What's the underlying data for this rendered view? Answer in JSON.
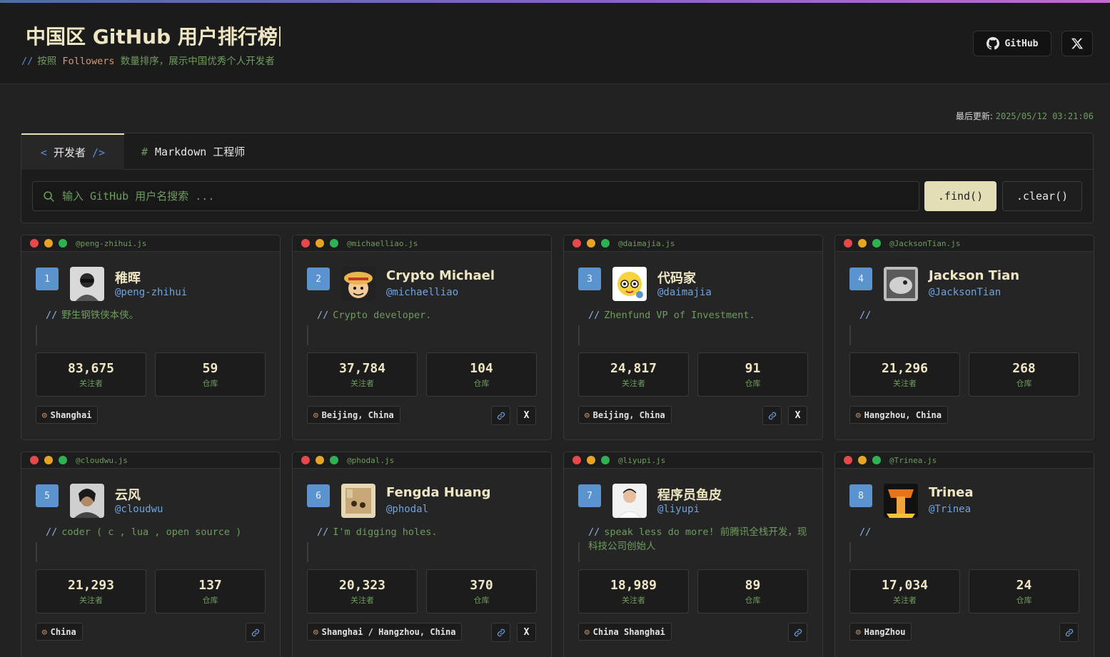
{
  "header": {
    "title": "中国区 GitHub 用户排行榜",
    "subtitle_slash": "//",
    "subtitle_pre": "按照 ",
    "subtitle_highlight": "Followers",
    "subtitle_post": " 数量排序，展示中国优秀个人开发者",
    "github_label": "GitHub"
  },
  "updated": {
    "label": "最后更新:",
    "timestamp": "2025/05/12 03:21:06"
  },
  "tabs": {
    "developers": {
      "open": "<",
      "label": "开发者",
      "close": "/>"
    },
    "markdown": {
      "hash": "#",
      "label": "Markdown 工程师"
    }
  },
  "search": {
    "placeholder": "输入 GitHub 用户名搜索 ...",
    "find_label": ".find()",
    "clear_label": ".clear()"
  },
  "labels": {
    "followers": "关注者",
    "repos": "仓库",
    "bio_prefix": "//"
  },
  "users": [
    {
      "rank": "1",
      "file": "@peng-zhihui.js",
      "name": "稚晖",
      "handle": "@peng-zhihui",
      "bio": "野生钢铁侠本侠。",
      "followers": "83,675",
      "repos": "59",
      "location": "Shanghai",
      "link": false,
      "x": false
    },
    {
      "rank": "2",
      "file": "@michaelliao.js",
      "name": "Crypto Michael",
      "handle": "@michaelliao",
      "bio": "Crypto developer.",
      "followers": "37,784",
      "repos": "104",
      "location": "Beijing, China",
      "link": true,
      "x": true
    },
    {
      "rank": "3",
      "file": "@daimajia.js",
      "name": "代码家",
      "handle": "@daimajia",
      "bio": "Zhenfund VP of Investment.",
      "followers": "24,817",
      "repos": "91",
      "location": "Beijing, China",
      "link": true,
      "x": true
    },
    {
      "rank": "4",
      "file": "@JacksonTian.js",
      "name": "Jackson Tian",
      "handle": "@JacksonTian",
      "bio": "",
      "followers": "21,296",
      "repos": "268",
      "location": "Hangzhou, China",
      "link": false,
      "x": false
    },
    {
      "rank": "5",
      "file": "@cloudwu.js",
      "name": "云风",
      "handle": "@cloudwu",
      "bio": "coder ( c , lua , open source )",
      "followers": "21,293",
      "repos": "137",
      "location": "China",
      "link": true,
      "x": false
    },
    {
      "rank": "6",
      "file": "@phodal.js",
      "name": "Fengda Huang",
      "handle": "@phodal",
      "bio": "I'm digging holes.",
      "followers": "20,323",
      "repos": "370",
      "location": "Shanghai / Hangzhou, China",
      "link": true,
      "x": true
    },
    {
      "rank": "7",
      "file": "@liyupi.js",
      "name": "程序员鱼皮",
      "handle": "@liyupi",
      "bio": "speak less do more! 前腾讯全栈开发，现科技公司创始人",
      "followers": "18,989",
      "repos": "89",
      "location": "China Shanghai",
      "link": true,
      "x": false
    },
    {
      "rank": "8",
      "file": "@Trinea.js",
      "name": "Trinea",
      "handle": "@Trinea",
      "bio": "",
      "followers": "17,034",
      "repos": "24",
      "location": "HangZhou",
      "link": true,
      "x": false
    }
  ],
  "colors": {
    "accent": "#e3deb6",
    "rank_badge": "#5b93cf",
    "comment_green": "#6f9c5f",
    "link_blue": "#6fa3de",
    "location_pin": "#d9986a"
  }
}
